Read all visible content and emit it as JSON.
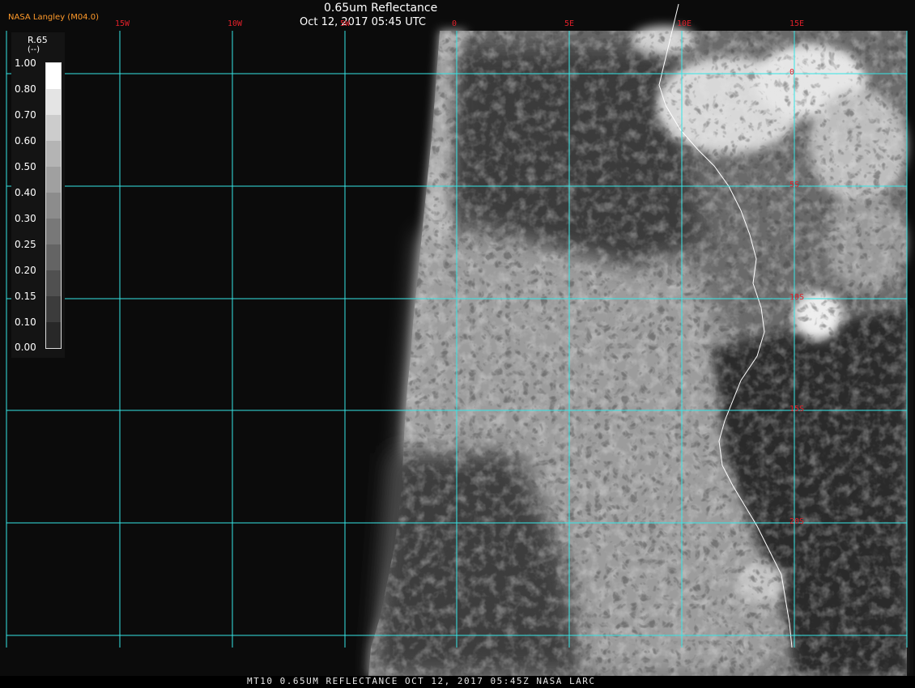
{
  "header": {
    "agency": "NASA Langley (M04.0)",
    "title": "0.65um Reflectance",
    "timestamp": "Oct 12, 2017 05:45 UTC"
  },
  "footer": {
    "caption": "MT10  0.65UM REFLECTANCE   OCT 12, 2017 05:45Z   NASA LARC"
  },
  "legend": {
    "variable": "R.65",
    "unit": "(--)",
    "ticks": [
      "1.00",
      "0.80",
      "0.70",
      "0.60",
      "0.50",
      "0.40",
      "0.30",
      "0.25",
      "0.20",
      "0.15",
      "0.10",
      "0.00"
    ],
    "colors": [
      "#ffffff",
      "#e4e4e4",
      "#cccccc",
      "#b4b4b4",
      "#a0a0a0",
      "#8c8c8c",
      "#787878",
      "#646464",
      "#505050",
      "#3c3c3c",
      "#282828"
    ]
  },
  "grid": {
    "longitude_labels": [
      "15W",
      "10W",
      "5W",
      "0",
      "5E",
      "10E",
      "15E"
    ],
    "latitude_labels": [
      "0",
      "5S",
      "10S",
      "15S",
      "20S"
    ],
    "line_color": "#36e6e6",
    "label_color": "#e0202a"
  },
  "colors": {
    "background": "#0b0b0b",
    "coastline": "#ffffff"
  }
}
